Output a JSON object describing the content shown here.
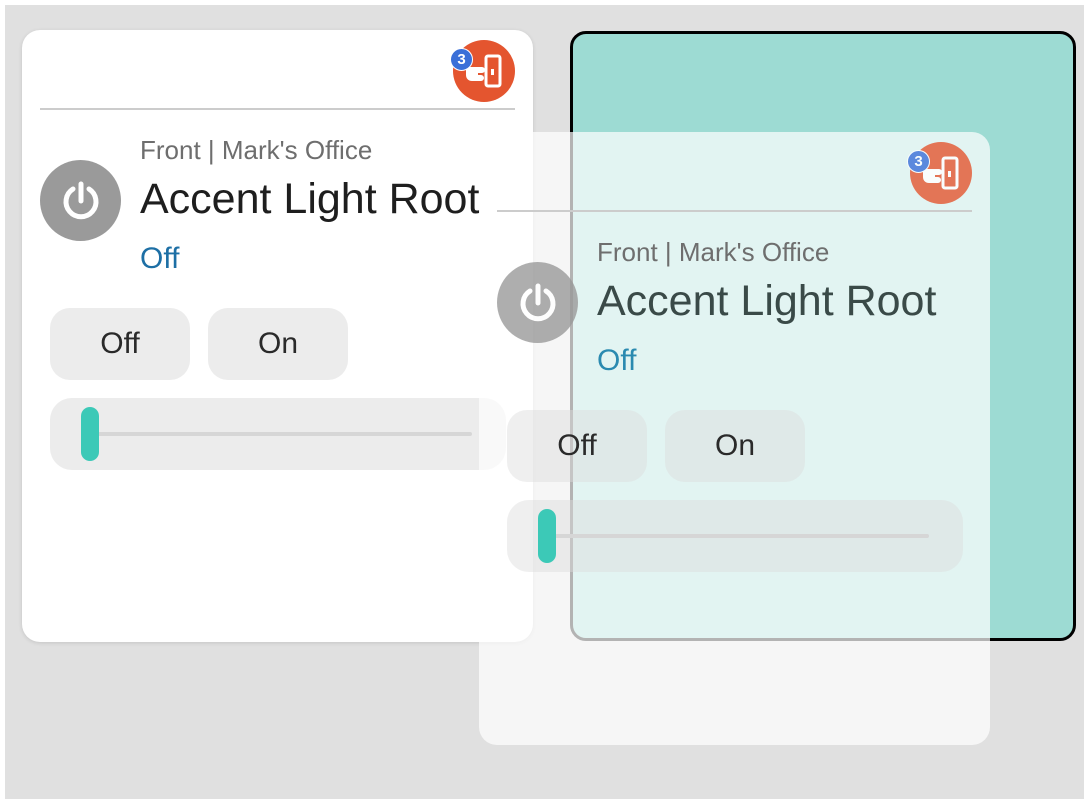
{
  "colors": {
    "background": "#e0e0e0",
    "card": "#ffffff",
    "drop_target": "#9ddbd3",
    "badge_button": "#e4552f",
    "badge_count": "#3a6fd8",
    "power_button": "#9a9a9a",
    "state_text": "#1d6fa5",
    "slider_thumb": "#3cc9b7"
  },
  "card": {
    "subtitle": "Front | Mark's Office",
    "title": "Accent Light Root",
    "state": "Off",
    "badge_count": "3",
    "badge_icon": "hand-pointing-exit-icon",
    "power_icon": "power-icon",
    "buttons": {
      "off_label": "Off",
      "on_label": "On"
    },
    "slider_value": 0
  },
  "ghost_card": {
    "subtitle": "Front | Mark's Office",
    "title": "Accent Light Root",
    "state": "Off",
    "badge_count": "3",
    "buttons": {
      "off_label": "Off",
      "on_label": "On"
    },
    "slider_value": 0
  }
}
